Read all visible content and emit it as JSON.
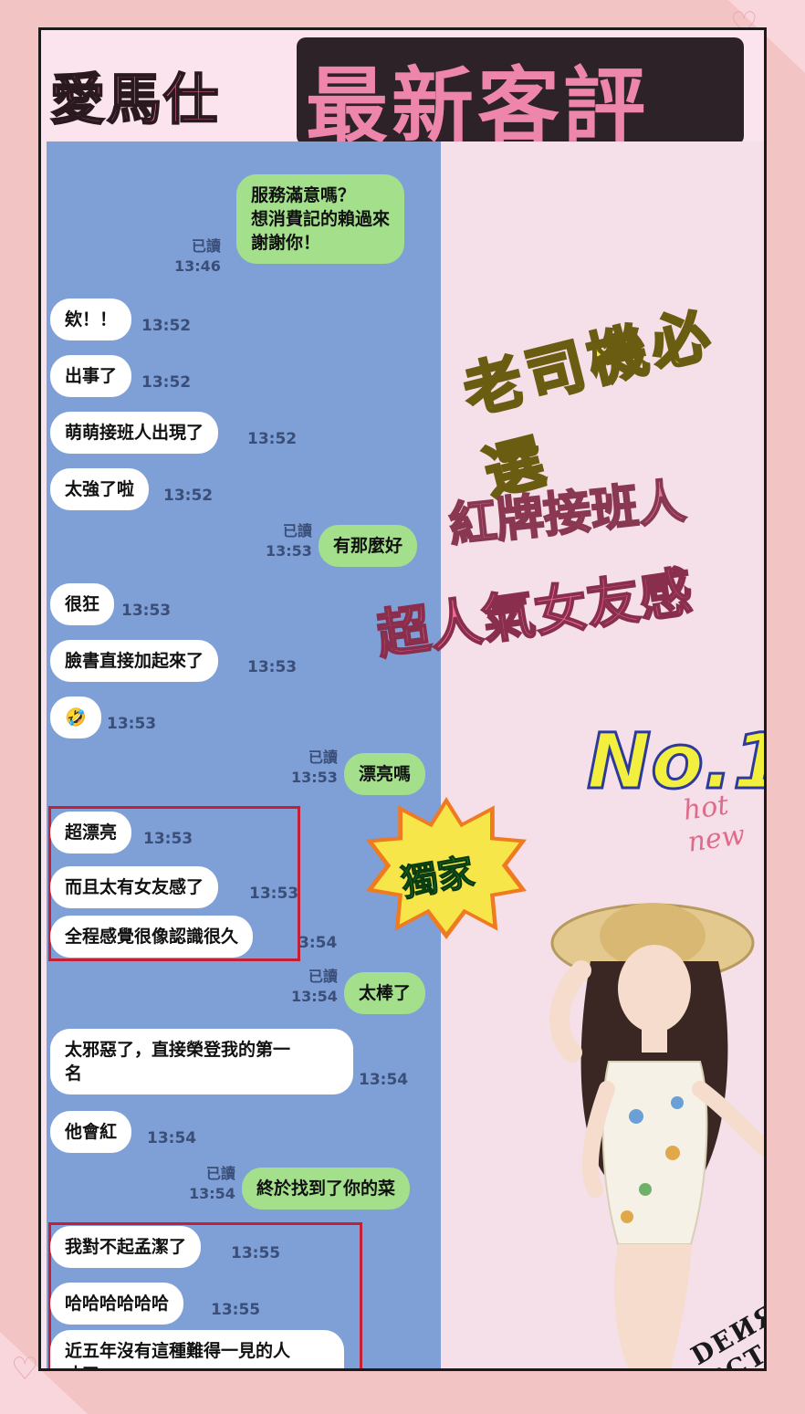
{
  "header": {
    "title_left": "愛馬仕",
    "title_right": "最新客評"
  },
  "chat": {
    "messages": [
      {
        "side": "right",
        "text": "服務滿意嗎？\n想消費記的賴過來\n謝謝你！",
        "read": "已讀",
        "time": "13:46"
      },
      {
        "side": "left",
        "text": "欸！！",
        "time": "13:52"
      },
      {
        "side": "left",
        "text": "出事了",
        "time": "13:52"
      },
      {
        "side": "left",
        "text": "萌萌接班人出現了",
        "time": "13:52"
      },
      {
        "side": "left",
        "text": "太強了啦",
        "time": "13:52"
      },
      {
        "side": "right",
        "text": "有那麼好",
        "read": "已讀",
        "time": "13:53"
      },
      {
        "side": "left",
        "text": "很狂",
        "time": "13:53"
      },
      {
        "side": "left",
        "text": "臉書直接加起來了",
        "time": "13:53"
      },
      {
        "side": "left",
        "text": "🤣",
        "time": "13:53"
      },
      {
        "side": "right",
        "text": "漂亮嗎",
        "read": "已讀",
        "time": "13:53"
      },
      {
        "side": "left",
        "text": "超漂亮",
        "time": "13:53"
      },
      {
        "side": "left",
        "text": "而且太有女友感了",
        "time": "13:53"
      },
      {
        "side": "left",
        "text": "全程感覺很像認識很久",
        "time": "3:54"
      },
      {
        "side": "right",
        "text": "太棒了",
        "read": "已讀",
        "time": "13:54"
      },
      {
        "side": "left",
        "text": "太邪惡了，直接榮登我的第一\n名",
        "time": "13:54"
      },
      {
        "side": "left",
        "text": "他會紅",
        "time": "13:54"
      },
      {
        "side": "right",
        "text": "終於找到了你的菜",
        "read": "已讀",
        "time": "13:54"
      },
      {
        "side": "left",
        "text": "我對不起孟潔了",
        "time": "13:55"
      },
      {
        "side": "left",
        "text": "哈哈哈哈哈哈",
        "time": "13:55"
      },
      {
        "side": "left",
        "text": "近五年沒有這種難得一見的人\n才了",
        "time": ""
      }
    ]
  },
  "slogans": {
    "s1": "老司機必選",
    "s2": "紅牌接班人",
    "s3": "超人氣女友感"
  },
  "badge": {
    "no1": "No.1",
    "hot_new": "hot new",
    "exclusive": "獨家"
  },
  "watermark": "DЕИЯ ЄCT",
  "colors": {
    "chat_bg": "#7f9fd7",
    "bubble_green": "#a4e08c",
    "highlight": "#c41f34",
    "title_pink": "#ee86ab"
  }
}
